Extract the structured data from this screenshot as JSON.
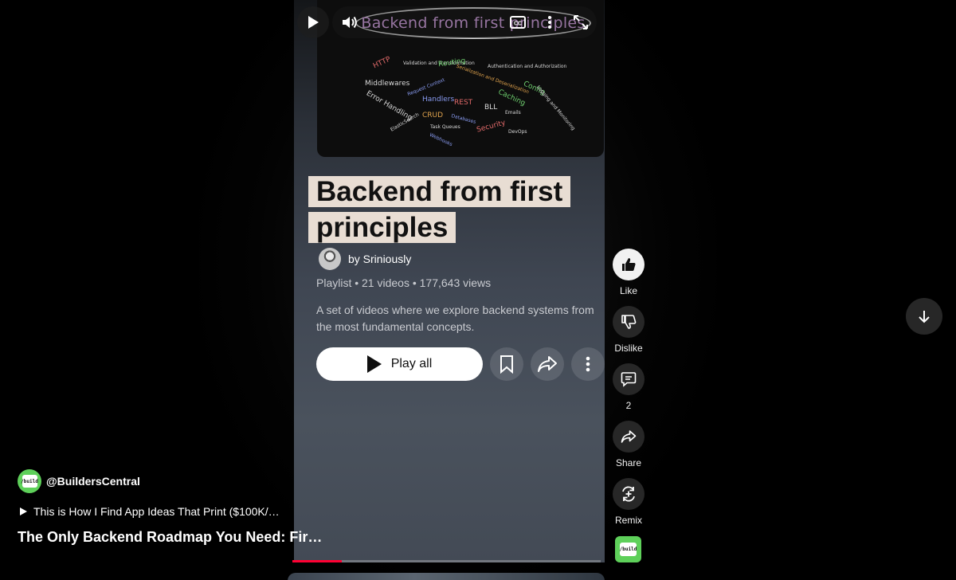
{
  "player": {
    "thumbnail_title": "Backend from first principles",
    "word_cloud": [
      {
        "text": "HTTP",
        "color": "#e26a6a"
      },
      {
        "text": "Validation and Transformation",
        "color": "#d9d9d9"
      },
      {
        "text": "Routing",
        "color": "#6fd06f"
      },
      {
        "text": "Authentication and Authorization",
        "color": "#d9d9d9"
      },
      {
        "text": "Middlewares",
        "color": "#d9d9d9"
      },
      {
        "text": "Request Context",
        "color": "#8a9cf2"
      },
      {
        "text": "Serialization and Deserialization",
        "color": "#e0a34d"
      },
      {
        "text": "Config",
        "color": "#6fd06f"
      },
      {
        "text": "Error Handling",
        "color": "#d9d9d9"
      },
      {
        "text": "Handlers",
        "color": "#8a9cf2"
      },
      {
        "text": "REST",
        "color": "#e26a6a"
      },
      {
        "text": "BLL",
        "color": "#d9d9d9"
      },
      {
        "text": "Caching",
        "color": "#6fd06f"
      },
      {
        "text": "Logging and Monitoring",
        "color": "#d9d9d9"
      },
      {
        "text": "CRUD",
        "color": "#e0a34d"
      },
      {
        "text": "Databases",
        "color": "#8a9cf2"
      },
      {
        "text": "Emails",
        "color": "#d9d9d9"
      },
      {
        "text": "ElasticSearch",
        "color": "#d9d9d9"
      },
      {
        "text": "Task Queues",
        "color": "#d9d9d9"
      },
      {
        "text": "Security",
        "color": "#e26a6a"
      },
      {
        "text": "DevOps",
        "color": "#d9d9d9"
      },
      {
        "text": "Webhooks",
        "color": "#8a9cf2"
      }
    ],
    "progress_fraction": 0.16
  },
  "playlist": {
    "title_line1": "Backend from first",
    "title_line2": "principles",
    "byline": "by Sriniously",
    "meta": "Playlist • 21 videos • 177,643 views",
    "description": "A set of videos where we explore backend systems from the most fundamental concepts.",
    "play_all_label": "Play all"
  },
  "actions": {
    "like_label": "Like",
    "dislike_label": "Dislike",
    "comments_count": "2",
    "share_label": "Share",
    "remix_label": "Remix"
  },
  "channel": {
    "handle": "@BuildersCentral",
    "avatar_text": "/build",
    "related_video": "This is How I Find App Ideas That Print ($100K/…",
    "video_title": "The Only Backend Roadmap You Need: Fir…"
  },
  "colors": {
    "accent": "#ff0033",
    "channel_green": "#5ed05a",
    "title_highlight": "#e8ddd3"
  }
}
